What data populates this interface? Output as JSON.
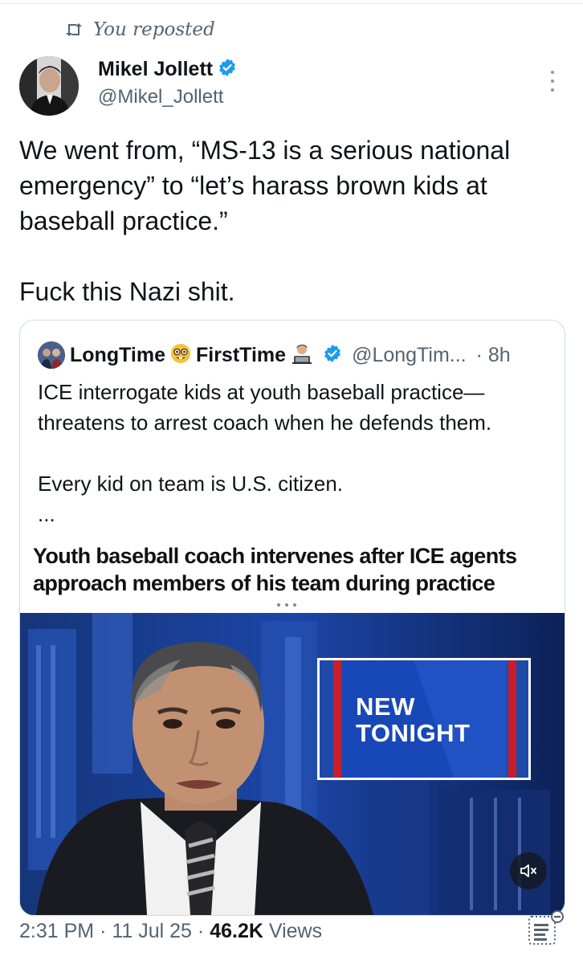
{
  "repost": {
    "label": "You reposted",
    "icon": "repost-icon"
  },
  "author": {
    "name": "Mikel Jollett",
    "handle": "@Mikel_Jollett",
    "verified": true
  },
  "tweet": {
    "text": "We went from, “MS-13 is a serious national emergency” to “let’s harass brown kids at baseball practice.”\n\nFuck this Nazi shit."
  },
  "quote": {
    "name_part1": "LongTime",
    "name_part2": "FirstTime",
    "handle": "@LongTim...",
    "time": "· 8h",
    "text": "ICE interrogate kids at youth baseball practice—\nthreatens to arrest coach when he defends them.\n\nEvery kid on team is U.S. citizen.\n...",
    "headline": "Youth baseball coach intervenes after ICE agents approach members of his team during practice",
    "video_caption": "NEW\nTONIGHT"
  },
  "meta": {
    "time": "2:31 PM",
    "date": "11 Jul 25",
    "views_count": "46.2K",
    "views_label": "Views"
  },
  "colors": {
    "verified": "#1d9bf0",
    "secondary": "#536471",
    "border": "#cfd9de",
    "news_blue": "#1f4aa8"
  }
}
